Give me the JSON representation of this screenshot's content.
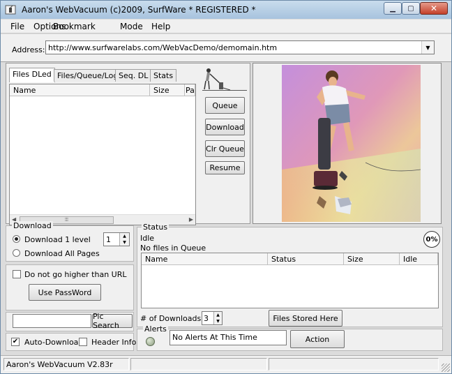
{
  "window": {
    "title": "Aaron's WebVacuum  (c)2009, SurfWare * REGISTERED *"
  },
  "menu": [
    "File",
    "Options",
    "Bookmark",
    "Mode",
    "Help"
  ],
  "address": {
    "label": "Address:",
    "value": "http://www.surfwarelabs.com/WebVacDemo/demomain.htm"
  },
  "tabs": [
    "Files DLed",
    "Files/Queue/Log",
    "Seq. DL",
    "Stats"
  ],
  "files_list": {
    "columns": [
      "Name",
      "Size",
      "Pa"
    ]
  },
  "side_buttons": [
    "Queue",
    "Download",
    "Clr Queue",
    "Resume"
  ],
  "download": {
    "group_label": "Download",
    "option_level": "Download 1 level",
    "option_all": "Download All Pages",
    "level_value": "1"
  },
  "options": {
    "no_higher": "Do not go higher than URL",
    "password_button": "Use PassWord"
  },
  "pic_search": {
    "value": "",
    "button": "Pic Search"
  },
  "auto": {
    "auto_download": "Auto-Download",
    "header_info": "Header Info"
  },
  "status": {
    "group_label": "Status",
    "state": "Idle",
    "queue_msg": "No files in Queue",
    "percent": "0%",
    "columns": [
      "Name",
      "Status",
      "Size",
      "Idle"
    ]
  },
  "downloads": {
    "label": "# of Downloads",
    "value": "3",
    "stored_button": "Files Stored Here"
  },
  "alerts": {
    "group_label": "Alerts",
    "text": "No Alerts At This Time",
    "action_button": "Action"
  },
  "statusbar": {
    "version": "Aaron's WebVacuum V2.83r"
  },
  "colors": {
    "close_button": "#c4402a",
    "titlebar": "#a7c3de"
  }
}
